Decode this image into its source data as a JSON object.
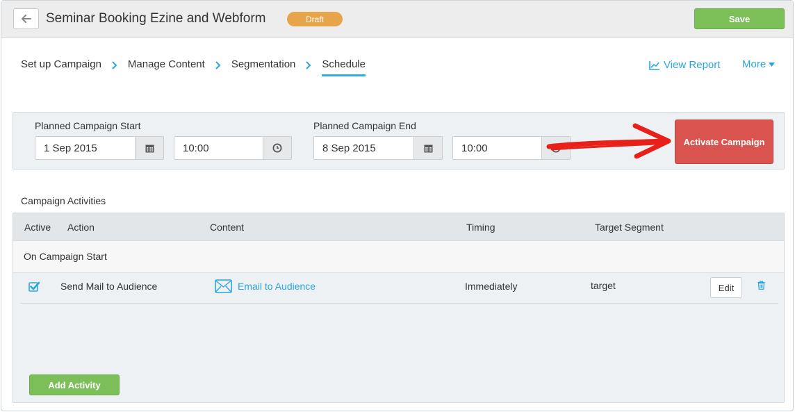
{
  "header": {
    "title": "Seminar Booking Ezine and Webform",
    "status_badge": "Draft",
    "save_label": "Save"
  },
  "wizard": {
    "steps": [
      "Set up Campaign",
      "Manage Content",
      "Segmentation",
      "Schedule"
    ],
    "active_step": "Schedule",
    "view_report_label": "View Report",
    "more_label": "More"
  },
  "schedule": {
    "start_label": "Planned Campaign Start",
    "start_date": "1 Sep 2015",
    "start_time": "10:00",
    "end_label": "Planned Campaign End",
    "end_date": "8 Sep 2015",
    "end_time": "10:00",
    "activate_label": "Activate Campaign"
  },
  "activities": {
    "section_title": "Campaign Activities",
    "columns": [
      "Active",
      "Action",
      "Content",
      "Timing",
      "Target Segment"
    ],
    "group_label": "On Campaign Start",
    "rows": [
      {
        "active": true,
        "action": "Send Mail to Audience",
        "content": "Email to Audience",
        "timing": "Immediately",
        "target_segment": "target",
        "edit_label": "Edit"
      }
    ],
    "add_label": "Add Activity"
  },
  "colors": {
    "accent": "#2aa6de",
    "draft": "#e8a44b",
    "save_green": "#7cbf58",
    "activate_red": "#d9534f",
    "annotation_arrow": "#e8201a"
  },
  "icons": [
    "back-arrow-icon",
    "chevron-right-icon",
    "line-chart-icon",
    "caret-down-icon",
    "calendar-icon",
    "clock-icon",
    "checkbox-checked-icon",
    "envelope-icon",
    "trash-icon"
  ]
}
